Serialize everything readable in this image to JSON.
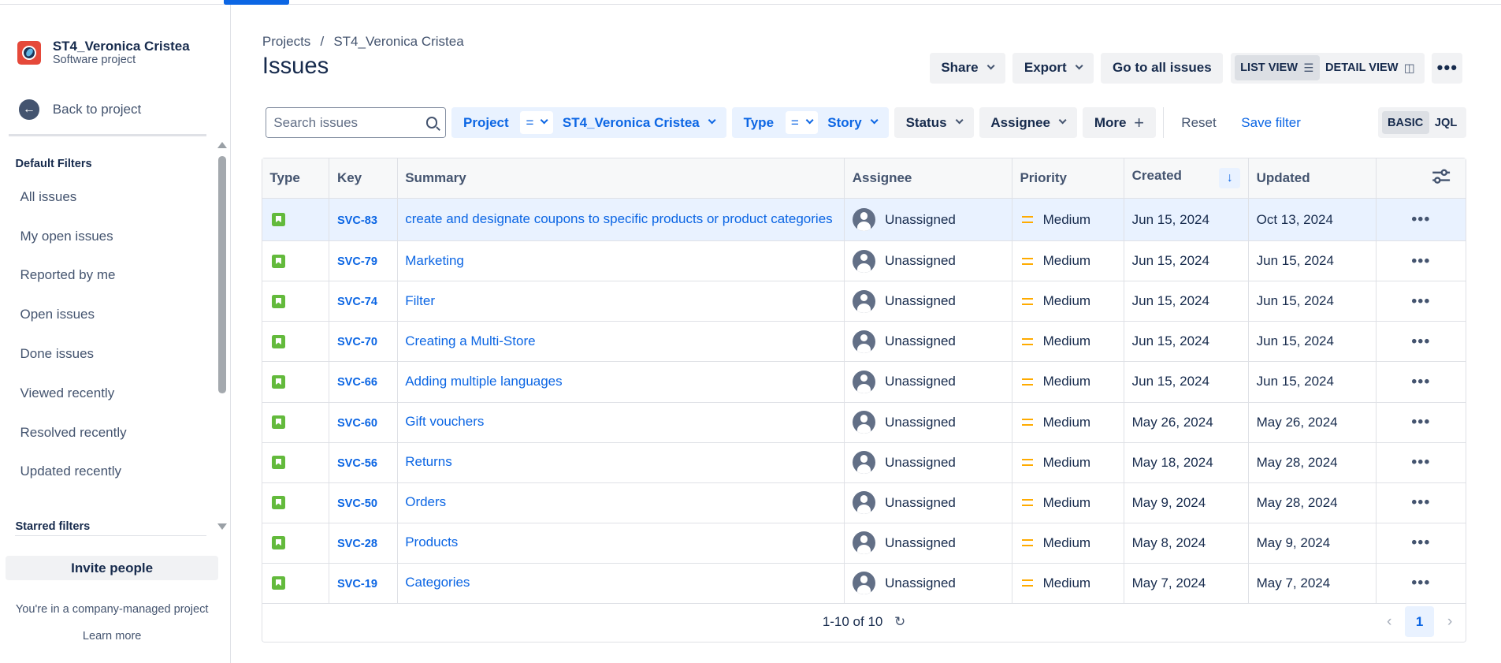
{
  "sidebar": {
    "project_name": "ST4_Veronica Cristea",
    "project_type": "Software project",
    "back_label": "Back to project",
    "default_filters_heading": "Default Filters",
    "filters": [
      "All issues",
      "My open issues",
      "Reported by me",
      "Open issues",
      "Done issues",
      "Viewed recently",
      "Resolved recently",
      "Updated recently"
    ],
    "starred_heading": "Starred filters",
    "invite_label": "Invite people",
    "company_note": "You're in a company-managed project",
    "learn_more": "Learn more"
  },
  "header": {
    "breadcrumb": [
      "Projects",
      "/",
      "ST4_Veronica Cristea"
    ],
    "title": "Issues",
    "share": "Share",
    "export": "Export",
    "go_all": "Go to all issues",
    "list_view": "LIST VIEW",
    "detail_view": "DETAIL VIEW",
    "more": "•••"
  },
  "filterbar": {
    "search_placeholder": "Search issues",
    "project_label": "Project",
    "project_op": "=",
    "project_value": "ST4_Veronica Cristea",
    "type_label": "Type",
    "type_op": "=",
    "type_value": "Story",
    "status": "Status",
    "assignee": "Assignee",
    "more": "More",
    "reset": "Reset",
    "save_filter": "Save filter",
    "basic": "BASIC",
    "jql": "JQL"
  },
  "table": {
    "headers": {
      "type": "Type",
      "key": "Key",
      "summary": "Summary",
      "assignee": "Assignee",
      "priority": "Priority",
      "created": "Created",
      "updated": "Updated"
    },
    "rows": [
      {
        "key": "SVC-83",
        "summary": "create and designate coupons to specific products or product categories",
        "assignee": "Unassigned",
        "priority": "Medium",
        "created": "Jun 15, 2024",
        "updated": "Oct 13, 2024"
      },
      {
        "key": "SVC-79",
        "summary": "Marketing",
        "assignee": "Unassigned",
        "priority": "Medium",
        "created": "Jun 15, 2024",
        "updated": "Jun 15, 2024"
      },
      {
        "key": "SVC-74",
        "summary": "Filter",
        "assignee": "Unassigned",
        "priority": "Medium",
        "created": "Jun 15, 2024",
        "updated": "Jun 15, 2024"
      },
      {
        "key": "SVC-70",
        "summary": "Creating a Multi-Store",
        "assignee": "Unassigned",
        "priority": "Medium",
        "created": "Jun 15, 2024",
        "updated": "Jun 15, 2024"
      },
      {
        "key": "SVC-66",
        "summary": "Adding multiple languages",
        "assignee": "Unassigned",
        "priority": "Medium",
        "created": "Jun 15, 2024",
        "updated": "Jun 15, 2024"
      },
      {
        "key": "SVC-60",
        "summary": "Gift vouchers",
        "assignee": "Unassigned",
        "priority": "Medium",
        "created": "May 26, 2024",
        "updated": "May 26, 2024"
      },
      {
        "key": "SVC-56",
        "summary": "Returns",
        "assignee": "Unassigned",
        "priority": "Medium",
        "created": "May 18, 2024",
        "updated": "May 28, 2024"
      },
      {
        "key": "SVC-50",
        "summary": "Orders",
        "assignee": "Unassigned",
        "priority": "Medium",
        "created": "May 9, 2024",
        "updated": "May 28, 2024"
      },
      {
        "key": "SVC-28",
        "summary": "Products",
        "assignee": "Unassigned",
        "priority": "Medium",
        "created": "May 8, 2024",
        "updated": "May 9, 2024"
      },
      {
        "key": "SVC-19",
        "summary": "Categories",
        "assignee": "Unassigned",
        "priority": "Medium",
        "created": "May 7, 2024",
        "updated": "May 7, 2024"
      }
    ],
    "row_more": "•••",
    "count_text": "1-10 of 10",
    "current_page": "1"
  },
  "icons": {
    "back": "arrow-left-icon",
    "search": "search-icon",
    "story": "story-icon",
    "priority_medium": "priority-medium-icon",
    "avatar": "user-avatar-icon",
    "sort": "arrow-down-icon",
    "column_settings": "sliders-icon",
    "refresh": "refresh-icon"
  },
  "colors": {
    "accent": "#0c66e4",
    "story": "#63ba3c",
    "priority_medium": "#ffab00",
    "selected_row": "#e9f2ff"
  }
}
